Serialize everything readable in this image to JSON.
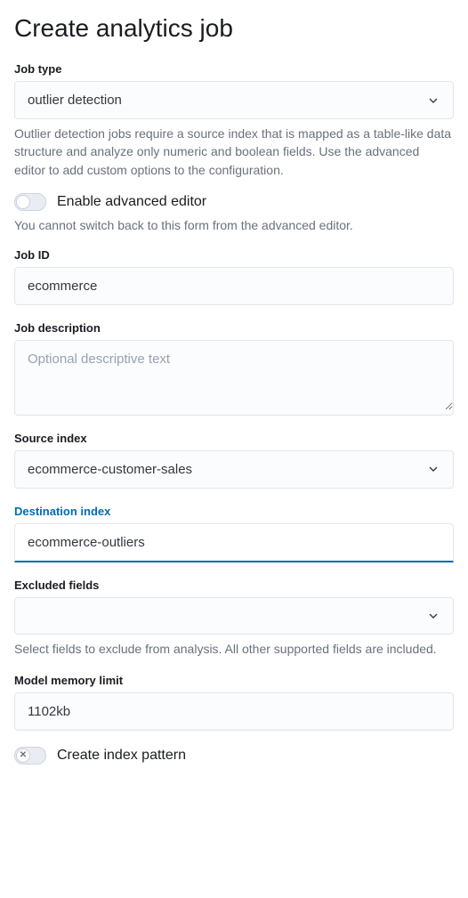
{
  "page_title": "Create analytics job",
  "job_type": {
    "label": "Job type",
    "value": "outlier detection",
    "help": "Outlier detection jobs require a source index that is mapped as a table-like data structure and analyze only numeric and boolean fields. Use the advanced editor to add custom options to the configuration."
  },
  "advanced_editor": {
    "label": "Enable advanced editor",
    "help": "You cannot switch back to this form from the advanced editor."
  },
  "job_id": {
    "label": "Job ID",
    "value": "ecommerce"
  },
  "job_description": {
    "label": "Job description",
    "placeholder": "Optional descriptive text"
  },
  "source_index": {
    "label": "Source index",
    "value": "ecommerce-customer-sales"
  },
  "destination_index": {
    "label": "Destination index",
    "value": "ecommerce-outliers"
  },
  "excluded_fields": {
    "label": "Excluded fields",
    "value": "",
    "help": "Select fields to exclude from analysis. All other supported fields are included."
  },
  "model_memory": {
    "label": "Model memory limit",
    "value": "1102kb"
  },
  "create_index_pattern": {
    "label": "Create index pattern"
  }
}
